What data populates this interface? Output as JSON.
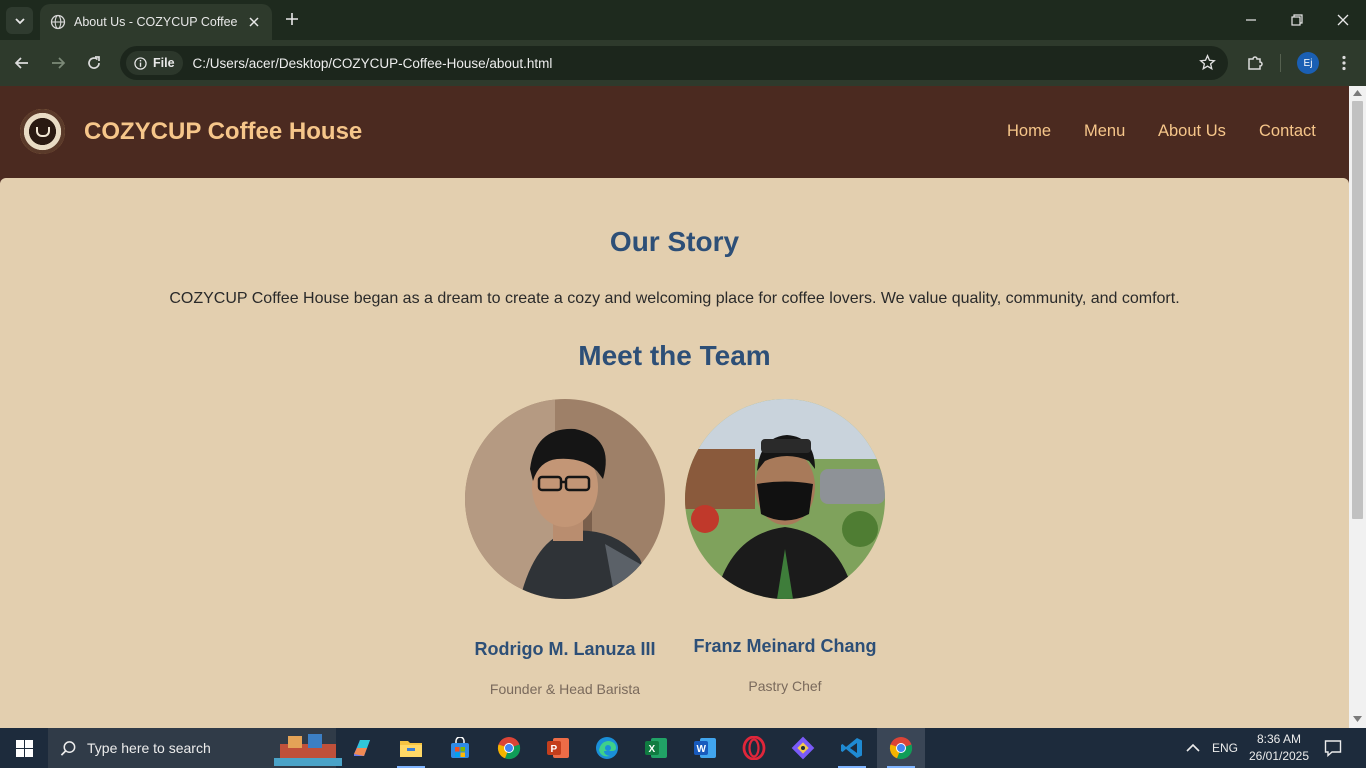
{
  "browser": {
    "tab_title": "About Us - COZYCUP Coffee House",
    "site_info_label": "File",
    "url": "C:/Users/acer/Desktop/COZYCUP-Coffee-House/about.html",
    "profile_initials": "Ej"
  },
  "site": {
    "brand": "COZYCUP Coffee House",
    "nav": [
      "Home",
      "Menu",
      "About Us",
      "Contact"
    ]
  },
  "page": {
    "story_heading": "Our Story",
    "story_text": "COZYCUP Coffee House began as a dream to create a cozy and welcoming place for coffee lovers. We value quality, community, and comfort.",
    "team_heading": "Meet the Team",
    "team": [
      {
        "name": "Rodrigo M. Lanuza III",
        "role": "Founder & Head Barista"
      },
      {
        "name": "Franz Meinard Chang",
        "role": "Pastry Chef"
      }
    ]
  },
  "taskbar": {
    "search_placeholder": "Type here to search",
    "language": "ENG",
    "time": "8:36 AM",
    "date": "26/01/2025",
    "apps": [
      "copilot-icon",
      "file-explorer-icon",
      "store-icon",
      "chrome-icon",
      "powerpoint-icon",
      "edge-icon",
      "excel-icon",
      "word-icon",
      "opera-icon",
      "git-icon",
      "vscode-icon",
      "chrome-active-icon"
    ]
  }
}
